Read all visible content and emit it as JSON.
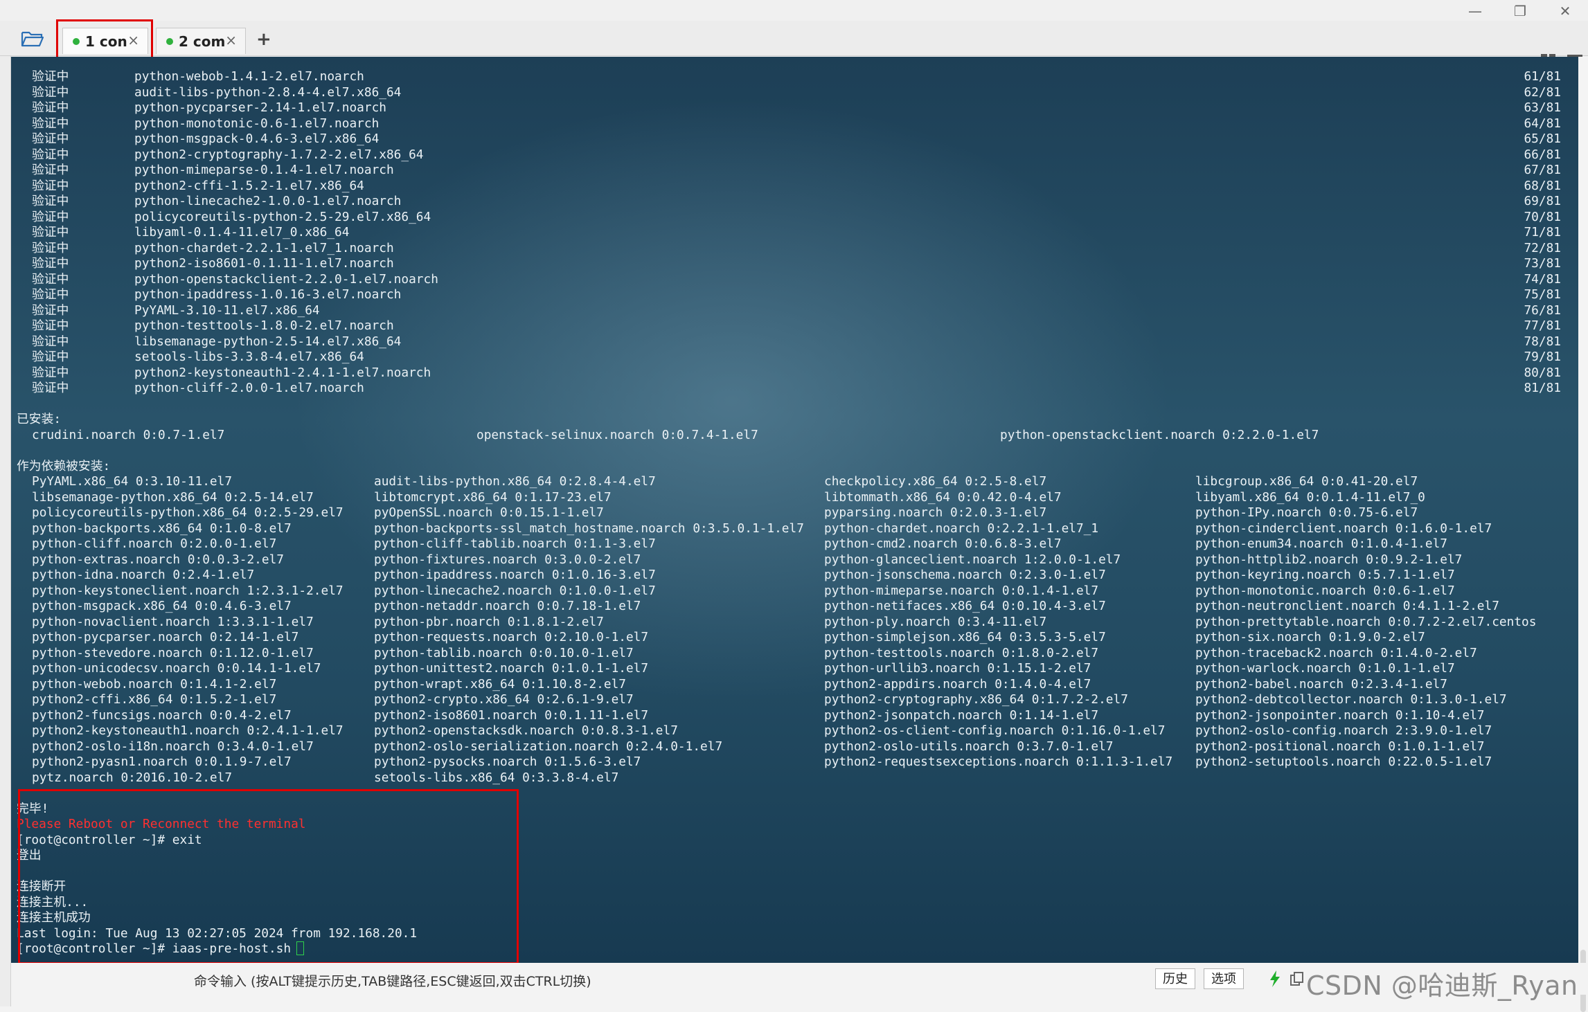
{
  "tabs": [
    {
      "label": "1 con",
      "close": "×"
    },
    {
      "label": "2 com",
      "close": "×"
    }
  ],
  "add_tab": "+",
  "window_controls": {
    "minimize": "—",
    "restore": "❐",
    "close": "✕"
  },
  "verify_label": "验证中",
  "verify": [
    {
      "pkg": "python-webob-1.4.1-2.el7.noarch",
      "count": "61/81"
    },
    {
      "pkg": "audit-libs-python-2.8.4-4.el7.x86_64",
      "count": "62/81"
    },
    {
      "pkg": "python-pycparser-2.14-1.el7.noarch",
      "count": "63/81"
    },
    {
      "pkg": "python-monotonic-0.6-1.el7.noarch",
      "count": "64/81"
    },
    {
      "pkg": "python-msgpack-0.4.6-3.el7.x86_64",
      "count": "65/81"
    },
    {
      "pkg": "python2-cryptography-1.7.2-2.el7.x86_64",
      "count": "66/81"
    },
    {
      "pkg": "python-mimeparse-0.1.4-1.el7.noarch",
      "count": "67/81"
    },
    {
      "pkg": "python2-cffi-1.5.2-1.el7.x86_64",
      "count": "68/81"
    },
    {
      "pkg": "python-linecache2-1.0.0-1.el7.noarch",
      "count": "69/81"
    },
    {
      "pkg": "policycoreutils-python-2.5-29.el7.x86_64",
      "count": "70/81"
    },
    {
      "pkg": "libyaml-0.1.4-11.el7_0.x86_64",
      "count": "71/81"
    },
    {
      "pkg": "python-chardet-2.2.1-1.el7_1.noarch",
      "count": "72/81"
    },
    {
      "pkg": "python2-iso8601-0.1.11-1.el7.noarch",
      "count": "73/81"
    },
    {
      "pkg": "python-openstackclient-2.2.0-1.el7.noarch",
      "count": "74/81"
    },
    {
      "pkg": "python-ipaddress-1.0.16-3.el7.noarch",
      "count": "75/81"
    },
    {
      "pkg": "PyYAML-3.10-11.el7.x86_64",
      "count": "76/81"
    },
    {
      "pkg": "python-testtools-1.8.0-2.el7.noarch",
      "count": "77/81"
    },
    {
      "pkg": "libsemanage-python-2.5-14.el7.x86_64",
      "count": "78/81"
    },
    {
      "pkg": "setools-libs-3.3.8-4.el7.x86_64",
      "count": "79/81"
    },
    {
      "pkg": "python2-keystoneauth1-2.4.1-1.el7.noarch",
      "count": "80/81"
    },
    {
      "pkg": "python-cliff-2.0.0-1.el7.noarch",
      "count": "81/81"
    }
  ],
  "installed_header": "已安装:",
  "installed": [
    "crudini.noarch 0:0.7-1.el7",
    "openstack-selinux.noarch 0:0.7.4-1.el7",
    "python-openstackclient.noarch 0:2.2.0-1.el7"
  ],
  "deps_header": "作为依赖被安装:",
  "deps": [
    [
      "PyYAML.x86_64 0:3.10-11.el7",
      "audit-libs-python.x86_64 0:2.8.4-4.el7",
      "checkpolicy.x86_64 0:2.5-8.el7",
      "libcgroup.x86_64 0:0.41-20.el7"
    ],
    [
      "libsemanage-python.x86_64 0:2.5-14.el7",
      "libtomcrypt.x86_64 0:1.17-23.el7",
      "libtommath.x86_64 0:0.42.0-4.el7",
      "libyaml.x86_64 0:0.1.4-11.el7_0"
    ],
    [
      "policycoreutils-python.x86_64 0:2.5-29.el7",
      "pyOpenSSL.noarch 0:0.15.1-1.el7",
      "pyparsing.noarch 0:2.0.3-1.el7",
      "python-IPy.noarch 0:0.75-6.el7"
    ],
    [
      "python-backports.x86_64 0:1.0-8.el7",
      "python-backports-ssl_match_hostname.noarch 0:3.5.0.1-1.el7",
      "python-chardet.noarch 0:2.2.1-1.el7_1",
      "python-cinderclient.noarch 0:1.6.0-1.el7"
    ],
    [
      "python-cliff.noarch 0:2.0.0-1.el7",
      "python-cliff-tablib.noarch 0:1.1-3.el7",
      "python-cmd2.noarch 0:0.6.8-3.el7",
      "python-enum34.noarch 0:1.0.4-1.el7"
    ],
    [
      "python-extras.noarch 0:0.0.3-2.el7",
      "python-fixtures.noarch 0:3.0.0-2.el7",
      "python-glanceclient.noarch 1:2.0.0-1.el7",
      "python-httplib2.noarch 0:0.9.2-1.el7"
    ],
    [
      "python-idna.noarch 0:2.4-1.el7",
      "python-ipaddress.noarch 0:1.0.16-3.el7",
      "python-jsonschema.noarch 0:2.3.0-1.el7",
      "python-keyring.noarch 0:5.7.1-1.el7"
    ],
    [
      "python-keystoneclient.noarch 1:2.3.1-2.el7",
      "python-linecache2.noarch 0:1.0.0-1.el7",
      "python-mimeparse.noarch 0:0.1.4-1.el7",
      "python-monotonic.noarch 0:0.6-1.el7"
    ],
    [
      "python-msgpack.x86_64 0:0.4.6-3.el7",
      "python-netaddr.noarch 0:0.7.18-1.el7",
      "python-netifaces.x86_64 0:0.10.4-3.el7",
      "python-neutronclient.noarch 0:4.1.1-2.el7"
    ],
    [
      "python-novaclient.noarch 1:3.3.1-1.el7",
      "python-pbr.noarch 0:1.8.1-2.el7",
      "python-ply.noarch 0:3.4-11.el7",
      "python-prettytable.noarch 0:0.7.2-2.el7.centos"
    ],
    [
      "python-pycparser.noarch 0:2.14-1.el7",
      "python-requests.noarch 0:2.10.0-1.el7",
      "python-simplejson.x86_64 0:3.5.3-5.el7",
      "python-six.noarch 0:1.9.0-2.el7"
    ],
    [
      "python-stevedore.noarch 0:1.12.0-1.el7",
      "python-tablib.noarch 0:0.10.0-1.el7",
      "python-testtools.noarch 0:1.8.0-2.el7",
      "python-traceback2.noarch 0:1.4.0-2.el7"
    ],
    [
      "python-unicodecsv.noarch 0:0.14.1-1.el7",
      "python-unittest2.noarch 0:1.0.1-1.el7",
      "python-urllib3.noarch 0:1.15.1-2.el7",
      "python-warlock.noarch 0:1.0.1-1.el7"
    ],
    [
      "python-webob.noarch 0:1.4.1-2.el7",
      "python-wrapt.x86_64 0:1.10.8-2.el7",
      "python2-appdirs.noarch 0:1.4.0-4.el7",
      "python2-babel.noarch 0:2.3.4-1.el7"
    ],
    [
      "python2-cffi.x86_64 0:1.5.2-1.el7",
      "python2-crypto.x86_64 0:2.6.1-9.el7",
      "python2-cryptography.x86_64 0:1.7.2-2.el7",
      "python2-debtcollector.noarch 0:1.3.0-1.el7"
    ],
    [
      "python2-funcsigs.noarch 0:0.4-2.el7",
      "python2-iso8601.noarch 0:0.1.11-1.el7",
      "python2-jsonpatch.noarch 0:1.14-1.el7",
      "python2-jsonpointer.noarch 0:1.10-4.el7"
    ],
    [
      "python2-keystoneauth1.noarch 0:2.4.1-1.el7",
      "python2-openstacksdk.noarch 0:0.8.3-1.el7",
      "python2-os-client-config.noarch 0:1.16.0-1.el7",
      "python2-oslo-config.noarch 2:3.9.0-1.el7"
    ],
    [
      "python2-oslo-i18n.noarch 0:3.4.0-1.el7",
      "python2-oslo-serialization.noarch 0:2.4.0-1.el7",
      "python2-oslo-utils.noarch 0:3.7.0-1.el7",
      "python2-positional.noarch 0:1.0.1-1.el7"
    ],
    [
      "python2-pyasn1.noarch 0:0.1.9-7.el7",
      "python2-pysocks.noarch 0:1.5.6-3.el7",
      "python2-requestsexceptions.noarch 0:1.1.3-1.el7",
      "python2-setuptools.noarch 0:22.0.5-1.el7"
    ],
    [
      "pytz.noarch 0:2016.10-2.el7",
      "setools-libs.x86_64 0:3.3.8-4.el7",
      "",
      ""
    ]
  ],
  "output": {
    "done": "完毕!",
    "reboot_msg": "Please Reboot or Reconnect the terminal",
    "prompt_exit": "[root@controller ~]# exit",
    "logout": "登出",
    "disconnected": "连接断开",
    "connecting": "连接主机...",
    "connected": "连接主机成功",
    "last_login": "Last login: Tue Aug 13 02:27:05 2024 from 192.168.20.1",
    "prompt_cmd": "[root@controller ~]# iaas-pre-host.sh"
  },
  "cmdbar": {
    "hint": "命令输入 (按ALT键提示历史,TAB键路径,ESC键返回,双击CTRL切换)",
    "history_btn": "历史",
    "options_btn": "选项"
  },
  "watermark": "CSDN @哈迪斯_Ryan"
}
